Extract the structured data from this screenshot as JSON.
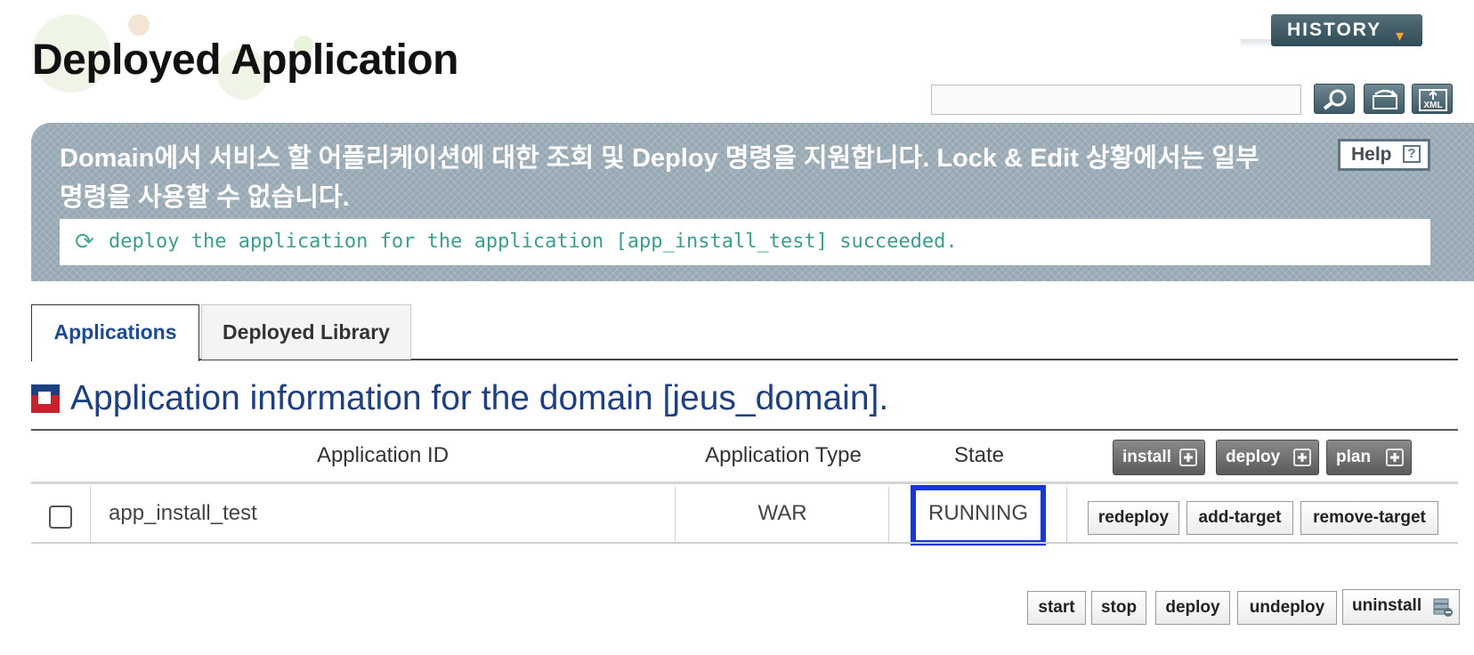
{
  "page_title": "Deployed Application",
  "history_button": "HISTORY",
  "search": {
    "value": "",
    "placeholder": ""
  },
  "toolbar_icons": [
    "search-icon",
    "refresh-icon",
    "xml-export-icon"
  ],
  "banner": {
    "description": "Domain에서 서비스 할 어플리케이션에 대한 조회 및 Deploy 명령을 지원합니다. Lock & Edit 상황에서는 일부 명령을 사용할 수 없습니다.",
    "help_label": "Help",
    "message": "deploy the application for the application [app_install_test] succeeded."
  },
  "tabs": [
    {
      "label": "Applications",
      "active": true
    },
    {
      "label": "Deployed Library",
      "active": false
    }
  ],
  "section_title": "Application information for the domain [jeus_domain].",
  "table": {
    "columns": [
      "Application ID",
      "Application Type",
      "State"
    ],
    "header_buttons": [
      "install",
      "deploy",
      "plan"
    ],
    "rows": [
      {
        "checked": false,
        "app_id": "app_install_test",
        "type": "WAR",
        "state": "RUNNING",
        "actions": [
          "redeploy",
          "add-target",
          "remove-target"
        ]
      }
    ]
  },
  "bottom_actions": [
    "start",
    "stop",
    "deploy",
    "undeploy",
    "uninstall"
  ],
  "colors": {
    "title_blue": "#1e3f80",
    "banner": "#97a8b3",
    "history": "#3a5660",
    "message_teal": "#3c9d8c",
    "highlight": "#1736d6"
  }
}
